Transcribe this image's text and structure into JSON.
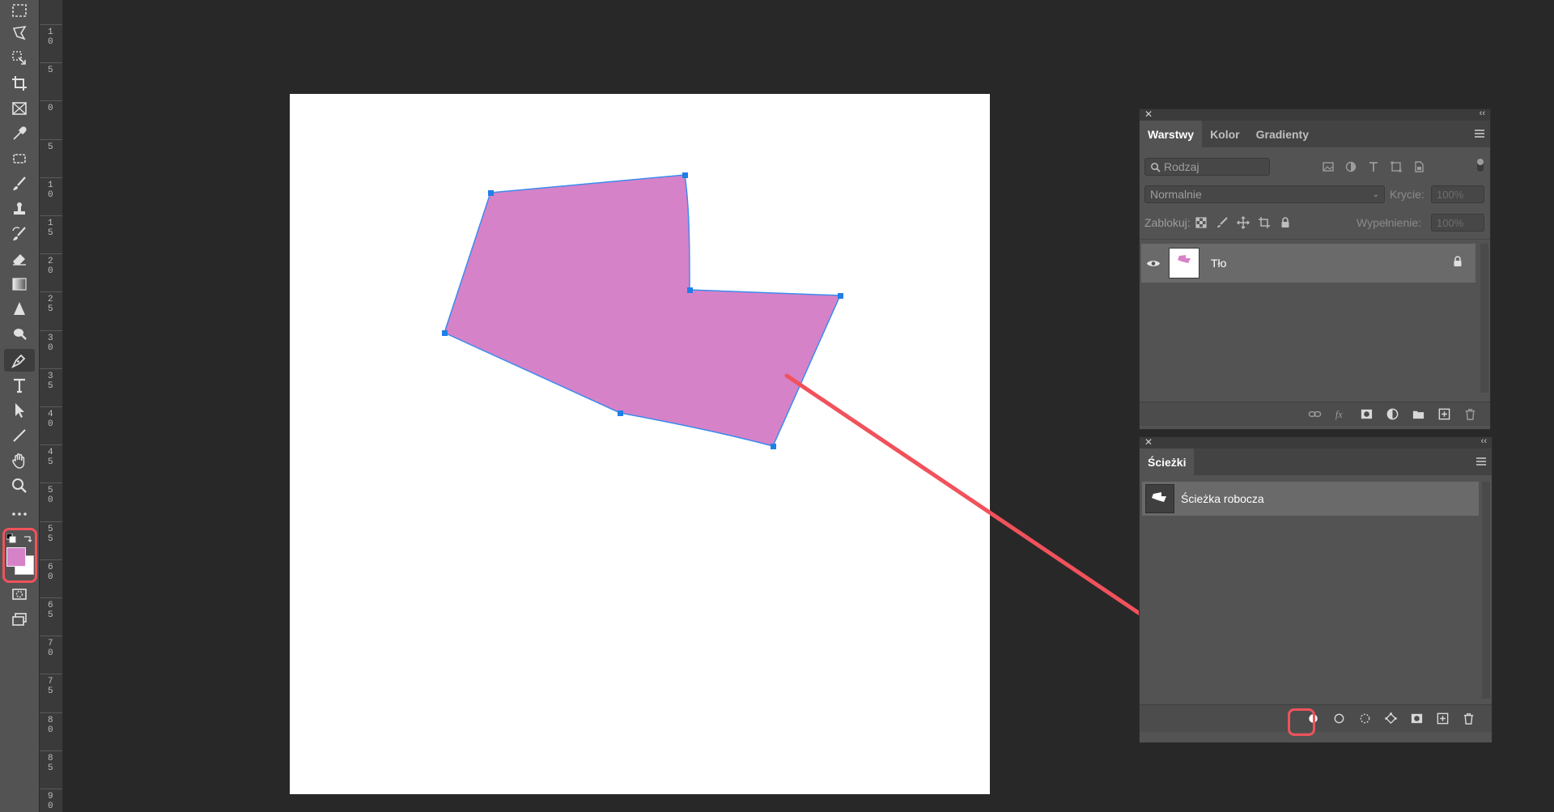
{
  "colors": {
    "foreground": "#d682c9",
    "background": "#ffffff",
    "path_stroke": "#3b8ced",
    "annotation": "#f0525c"
  },
  "ruler": {
    "labels": [
      "10",
      "5",
      "0",
      "5",
      "10",
      "15",
      "20",
      "25",
      "30",
      "35",
      "40",
      "45",
      "50",
      "55",
      "60",
      "65",
      "70",
      "75",
      "80",
      "85",
      "90"
    ]
  },
  "layers_panel": {
    "tabs": [
      "Warstwy",
      "Kolor",
      "Gradienty"
    ],
    "filter_placeholder": "Rodzaj",
    "blend_mode": "Normalnie",
    "opacity_label": "Krycie:",
    "opacity_value": "100%",
    "lock_label": "Zablokuj:",
    "fill_label": "Wypełnienie:",
    "fill_value": "100%",
    "layers": [
      {
        "name": "Tło",
        "visible": true,
        "locked": true
      }
    ]
  },
  "paths_panel": {
    "tab": "Ścieżki",
    "paths": [
      {
        "name": "Ścieżka robocza"
      }
    ]
  }
}
